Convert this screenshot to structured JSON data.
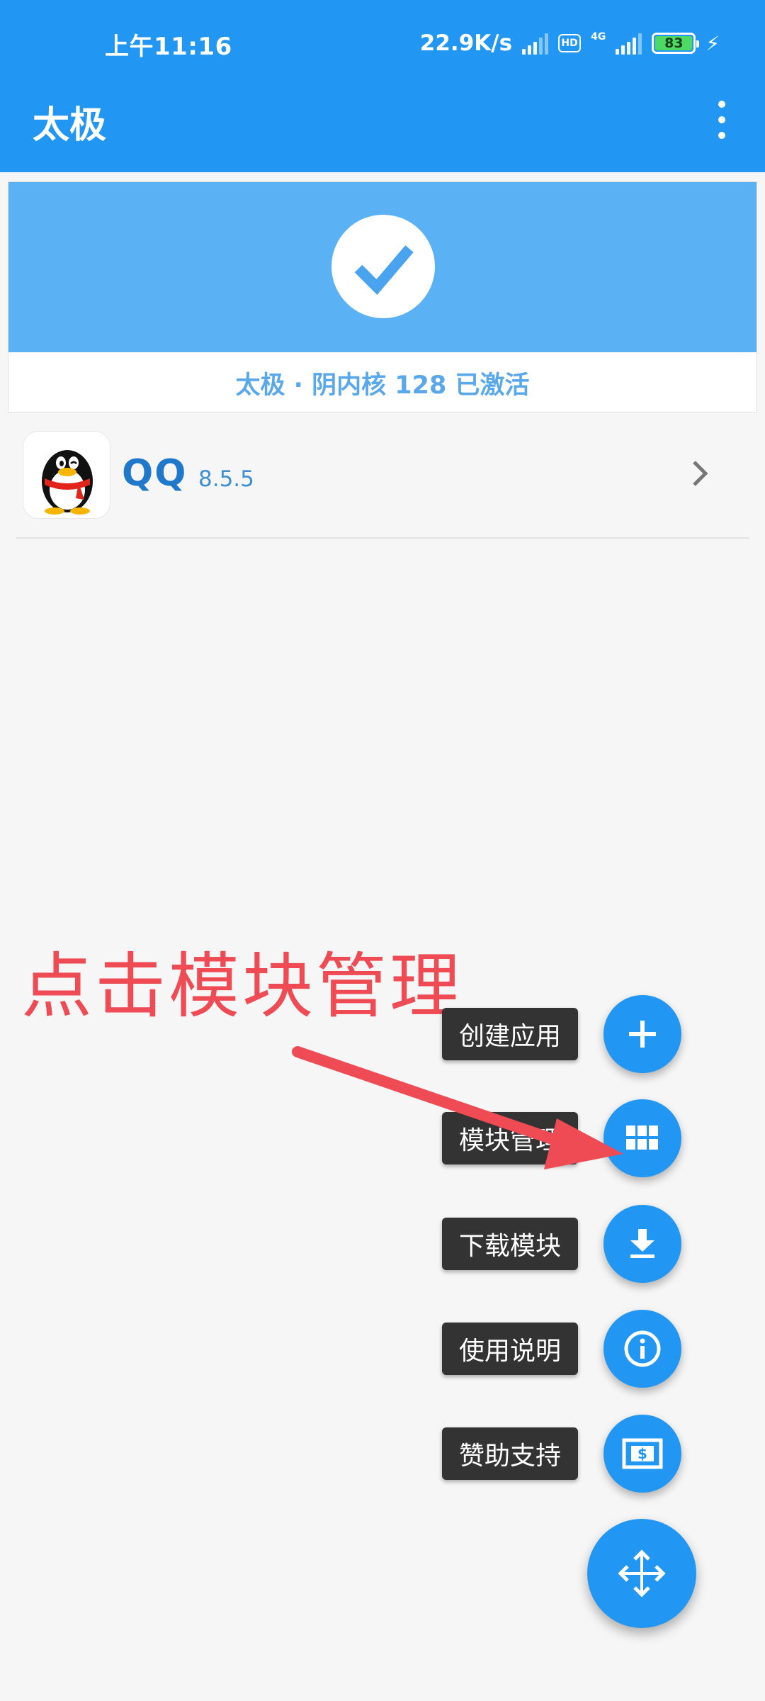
{
  "status_bar": {
    "time": "上午11:16",
    "net_speed": "22.9K/s",
    "hd_badge": "HD",
    "network_type": "4G",
    "battery_level": "83"
  },
  "app_bar": {
    "title": "太极"
  },
  "activation": {
    "status_text": "太极 · 阴内核 128 已激活"
  },
  "apps": [
    {
      "name": "QQ",
      "version": "8.5.5"
    }
  ],
  "annotation": {
    "text": "点击模块管理"
  },
  "fab_menu": {
    "items": [
      {
        "label": "创建应用",
        "icon": "plus-icon"
      },
      {
        "label": "模块管理",
        "icon": "grid-icon"
      },
      {
        "label": "下载模块",
        "icon": "download-icon"
      },
      {
        "label": "使用说明",
        "icon": "info-icon"
      },
      {
        "label": "赞助支持",
        "icon": "money-icon"
      }
    ],
    "main_icon": "move-arrows-icon"
  },
  "colors": {
    "primary": "#2196f3",
    "banner": "#5ab2f5",
    "annotation": "#ef4b55",
    "label_bg": "#333333"
  }
}
